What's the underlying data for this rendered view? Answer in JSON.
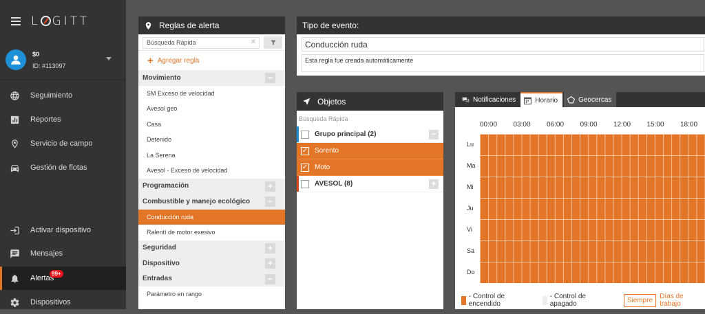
{
  "app": {
    "logo": "LOGITT"
  },
  "user": {
    "name": "$0",
    "id": "ID: #113097"
  },
  "nav": {
    "seguimiento": "Seguimiento",
    "reportes": "Reportes",
    "servicio": "Servicio de campo",
    "flotas": "Gestión de flotas",
    "activar": "Activar dispositivo",
    "mensajes": "Mensajes",
    "alertas": "Alertas",
    "alertas_badge": "99+",
    "dispositivos": "Dispositivos"
  },
  "reglas": {
    "title": "Reglas de alerta",
    "search_value": "Búsqueda Rápida",
    "add_label": "Agregar regla",
    "groups": [
      {
        "name": "Movimiento",
        "btn": "−",
        "rules": [
          "SM Exceso de velocidad",
          "Avesol geo",
          "Casa",
          "Detenido",
          "La Serena",
          "Avesol - Exceso de velocidad"
        ]
      },
      {
        "name": "Programación",
        "btn": "+",
        "rules": []
      },
      {
        "name": "Combustible y manejo ecológico",
        "btn": "−",
        "rules": [
          "Conducción ruda",
          "Ralentí de motor exesivo"
        ]
      },
      {
        "name": "Seguridad",
        "btn": "+",
        "rules": []
      },
      {
        "name": "Dispositivo",
        "btn": "+",
        "rules": []
      },
      {
        "name": "Entradas",
        "btn": "−",
        "rules": [
          "Parámetro en rango"
        ]
      }
    ],
    "selected_rule": "Conducción ruda"
  },
  "tipo": {
    "title": "Tipo de evento:",
    "value": "Conducción ruda",
    "description": "Esta regla fue creada automáticamente"
  },
  "objetos": {
    "title": "Objetos",
    "search_placeholder": "Búsqueda Rápida",
    "rows": [
      {
        "label": "Grupo principal (2)",
        "type": "group",
        "checked": false,
        "btn": "−",
        "bar": "#1e90d8"
      },
      {
        "label": "Sorento",
        "type": "item",
        "checked": true
      },
      {
        "label": "Moto",
        "type": "item",
        "checked": true
      },
      {
        "label": "AVESOL (8)",
        "type": "group",
        "checked": false,
        "btn": "+",
        "bar": "#e0441d"
      }
    ]
  },
  "horario": {
    "tabs": [
      "Notificaciones",
      "Horario",
      "Geocercas"
    ],
    "active_tab": "Horario",
    "hours": [
      "00:00",
      "03:00",
      "06:00",
      "09:00",
      "12:00",
      "15:00",
      "18:00"
    ],
    "days": [
      "Lu",
      "Ma",
      "Mi",
      "Ju",
      "Vi",
      "Sa",
      "Do"
    ],
    "legend_on": "- Control de encendido",
    "legend_off": "- Control de apagado",
    "btn_siempre": "Siempre",
    "link_dias": "Días de trabajo"
  },
  "colors": {
    "accent": "#e37526",
    "sidebar": "#333333",
    "badge": "#e8121a"
  }
}
